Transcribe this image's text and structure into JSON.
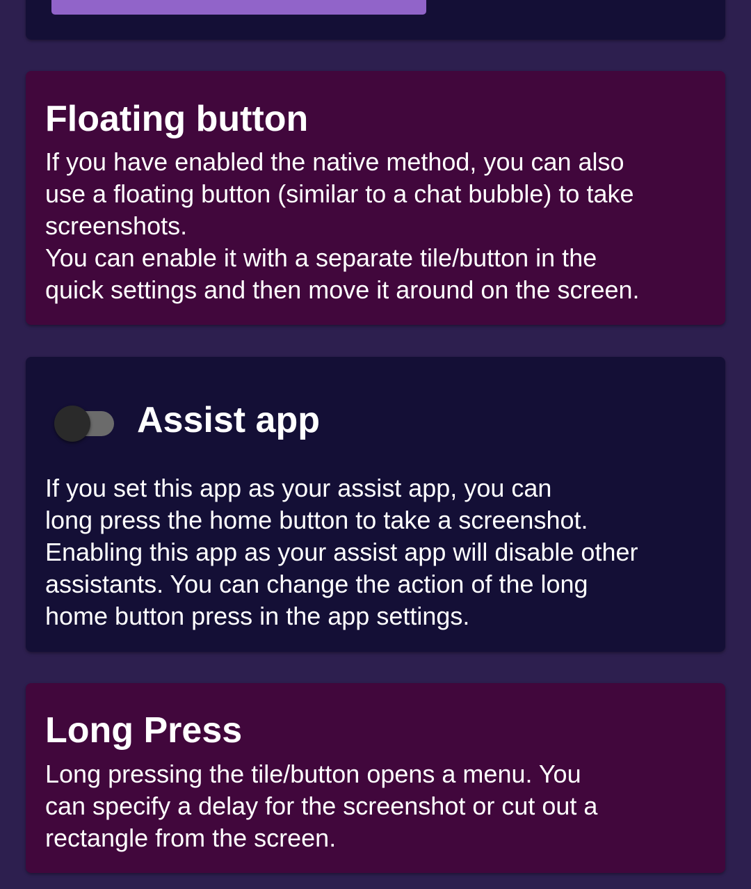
{
  "floating": {
    "title": "Floating button",
    "body_lines": [
      "If you have enabled the native method, you can also",
      "use a floating button (similar to a chat bubble) to take",
      "screenshots.",
      "You can enable it with a separate tile/button in the",
      "quick settings and then move it around on the screen."
    ]
  },
  "assist": {
    "title": "Assist app",
    "toggle_on": false,
    "body_lines": [
      "If you set this app as your assist app, you can",
      "long press the home button to take a screenshot.",
      "Enabling this app as your assist app will disable other",
      "assistants. You can change the action of the long",
      "home button press in the app settings."
    ]
  },
  "longpress": {
    "title": "Long Press",
    "body_lines": [
      "Long pressing the tile/button opens a menu. You",
      "can specify a delay for the screenshot or cut out a",
      "rectangle from the screen."
    ]
  },
  "colors": {
    "background": "#2d1f4f",
    "card_dark": "#140f36",
    "card_purple": "#41073c",
    "accent_button": "#9164c9"
  }
}
